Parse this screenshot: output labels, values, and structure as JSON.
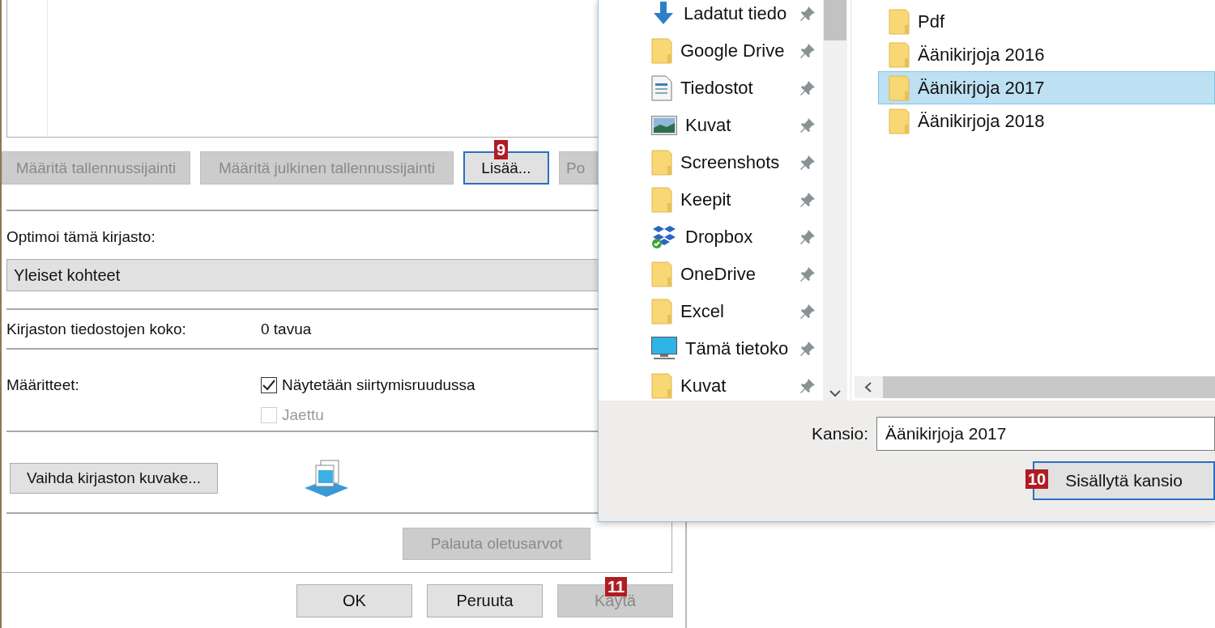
{
  "main_dialog": {
    "location_buttons": [
      {
        "label": "Määritä tallennussijainti",
        "disabled": true,
        "focused": false
      },
      {
        "label": "Määritä julkinen tallennussijainti",
        "disabled": true,
        "focused": false
      },
      {
        "label": "Lisää...",
        "disabled": false,
        "focused": true,
        "badge": "9"
      },
      {
        "label": "Po",
        "disabled": true,
        "focused": false
      }
    ],
    "optimize_label": "Optimoi tämä kirjasto:",
    "optimize_select": {
      "value": "Yleiset kohteet"
    },
    "size": {
      "label": "Kirjaston tiedostojen koko:",
      "value": "0 tavua"
    },
    "attributes": {
      "label": "Määritteet:",
      "options": [
        {
          "label": "Näytetään siirtymisruudussa",
          "checked": true,
          "disabled": false
        },
        {
          "label": "Jaettu",
          "checked": false,
          "disabled": true
        }
      ]
    },
    "change_icon_button": "Vaihda kirjaston kuvake...",
    "restore_button": {
      "label": "Palauta oletusarvot",
      "disabled": true
    },
    "footer_buttons": [
      {
        "label": "OK",
        "disabled": false
      },
      {
        "label": "Peruuta",
        "disabled": false
      },
      {
        "label": "Käytä",
        "disabled": true,
        "badge": "11"
      }
    ]
  },
  "folder_dialog": {
    "nav_items": [
      {
        "label": "Ladatut tiedo",
        "kind": "download",
        "pinned": true
      },
      {
        "label": "Google Drive",
        "kind": "folder",
        "pinned": true
      },
      {
        "label": "Tiedostot",
        "kind": "document",
        "pinned": true
      },
      {
        "label": "Kuvat",
        "kind": "picture",
        "pinned": true
      },
      {
        "label": "Screenshots",
        "kind": "folder",
        "pinned": true
      },
      {
        "label": "Keepit",
        "kind": "folder",
        "pinned": true
      },
      {
        "label": "Dropbox",
        "kind": "dropbox",
        "pinned": true
      },
      {
        "label": "OneDrive",
        "kind": "folder",
        "pinned": true
      },
      {
        "label": "Excel",
        "kind": "folder",
        "pinned": true
      },
      {
        "label": "Tämä tietoko",
        "kind": "monitor",
        "pinned": true
      },
      {
        "label": "Kuvat",
        "kind": "folder",
        "pinned": true
      }
    ],
    "folders": [
      {
        "label": "Pdf",
        "selected": false
      },
      {
        "label": "Äänikirjoja 2016",
        "selected": false
      },
      {
        "label": "Äänikirjoja 2017",
        "selected": true
      },
      {
        "label": "Äänikirjoja 2018",
        "selected": false
      }
    ],
    "folder_field": {
      "label": "Kansio:",
      "value": "Äänikirjoja 2017"
    },
    "include_button": {
      "label": "Sisällytä kansio",
      "badge": "10"
    }
  }
}
